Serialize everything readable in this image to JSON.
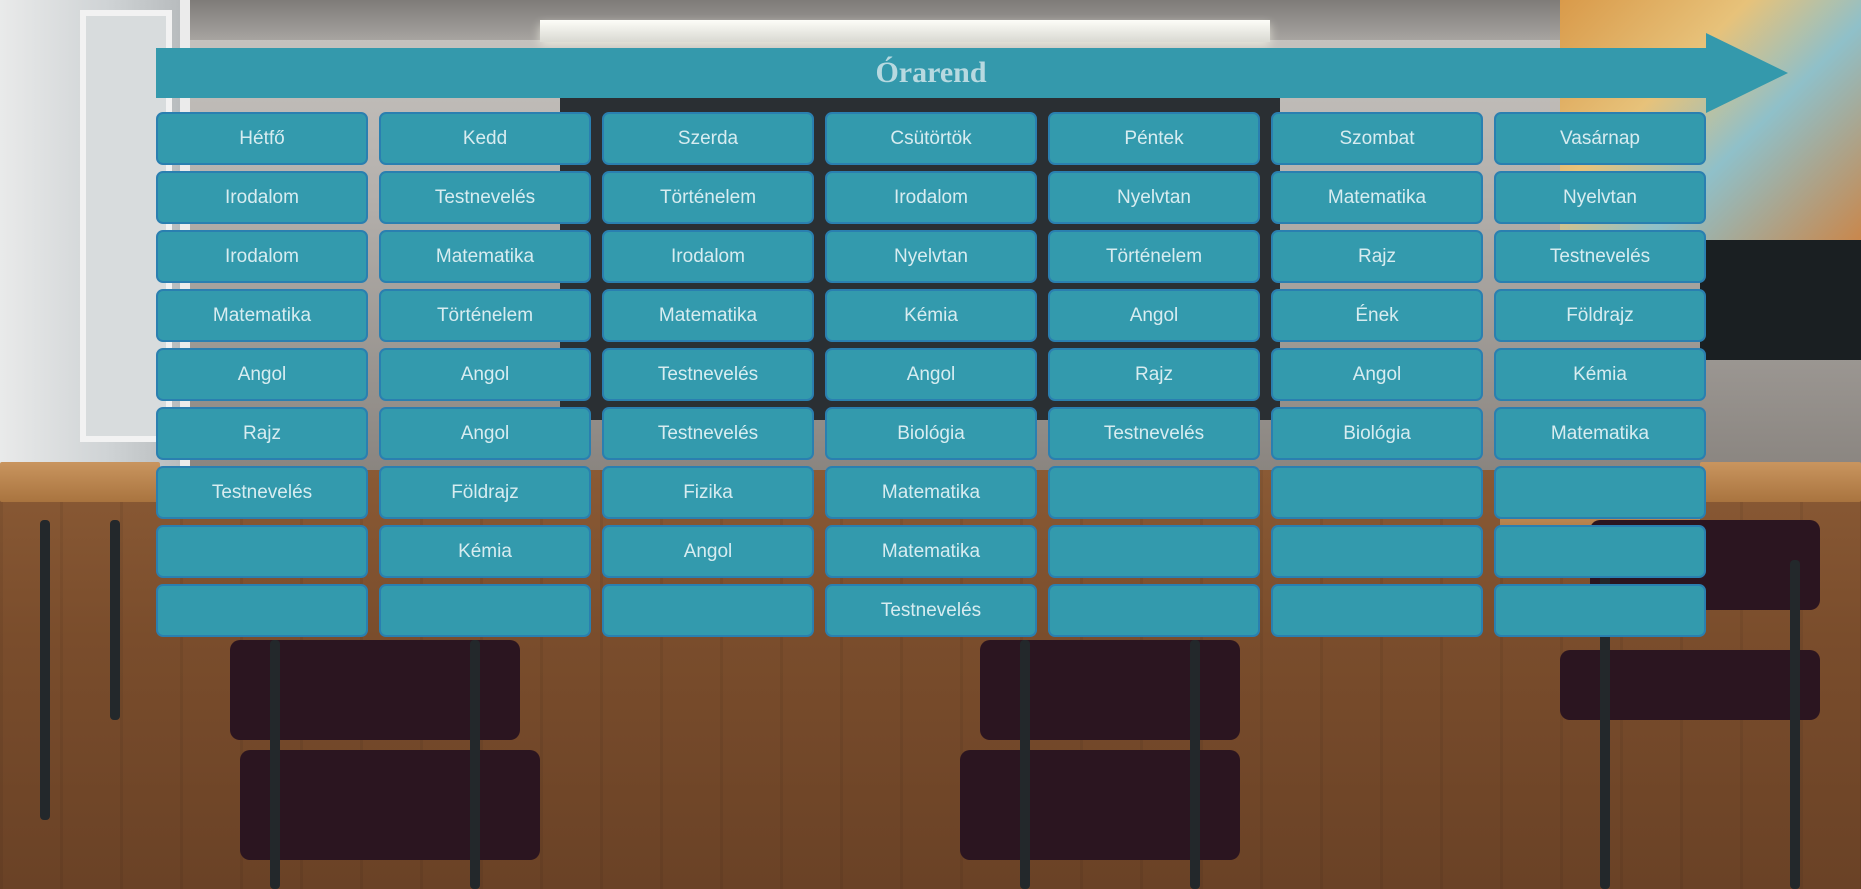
{
  "title": "Órarend",
  "colors": {
    "accent": "#3499ac",
    "cell_border": "#2a7fb0",
    "text": "#d7ecf0"
  },
  "days": [
    "Hétfő",
    "Kedd",
    "Szerda",
    "Csütörtök",
    "Péntek",
    "Szombat",
    "Vasárnap"
  ],
  "lessons": [
    [
      "Irodalom",
      "Testnevelés",
      "Történelem",
      "Irodalom",
      "Nyelvtan",
      "Matematika",
      "Nyelvtan"
    ],
    [
      "Irodalom",
      "Matematika",
      "Irodalom",
      "Nyelvtan",
      "Történelem",
      "Rajz",
      "Testnevelés"
    ],
    [
      "Matematika",
      "Történelem",
      "Matematika",
      "Kémia",
      "Angol",
      "Ének",
      "Földrajz"
    ],
    [
      "Angol",
      "Angol",
      "Testnevelés",
      "Angol",
      "Rajz",
      "Angol",
      "Kémia"
    ],
    [
      "Rajz",
      "Angol",
      "Testnevelés",
      "Biológia",
      "Testnevelés",
      "Biológia",
      "Matematika"
    ],
    [
      "Testnevelés",
      "Földrajz",
      "Fizika",
      "Matematika",
      "",
      "",
      ""
    ],
    [
      "",
      "Kémia",
      "Angol",
      "Matematika",
      "",
      "",
      ""
    ],
    [
      "",
      "",
      "",
      "Testnevelés",
      "",
      "",
      ""
    ]
  ]
}
